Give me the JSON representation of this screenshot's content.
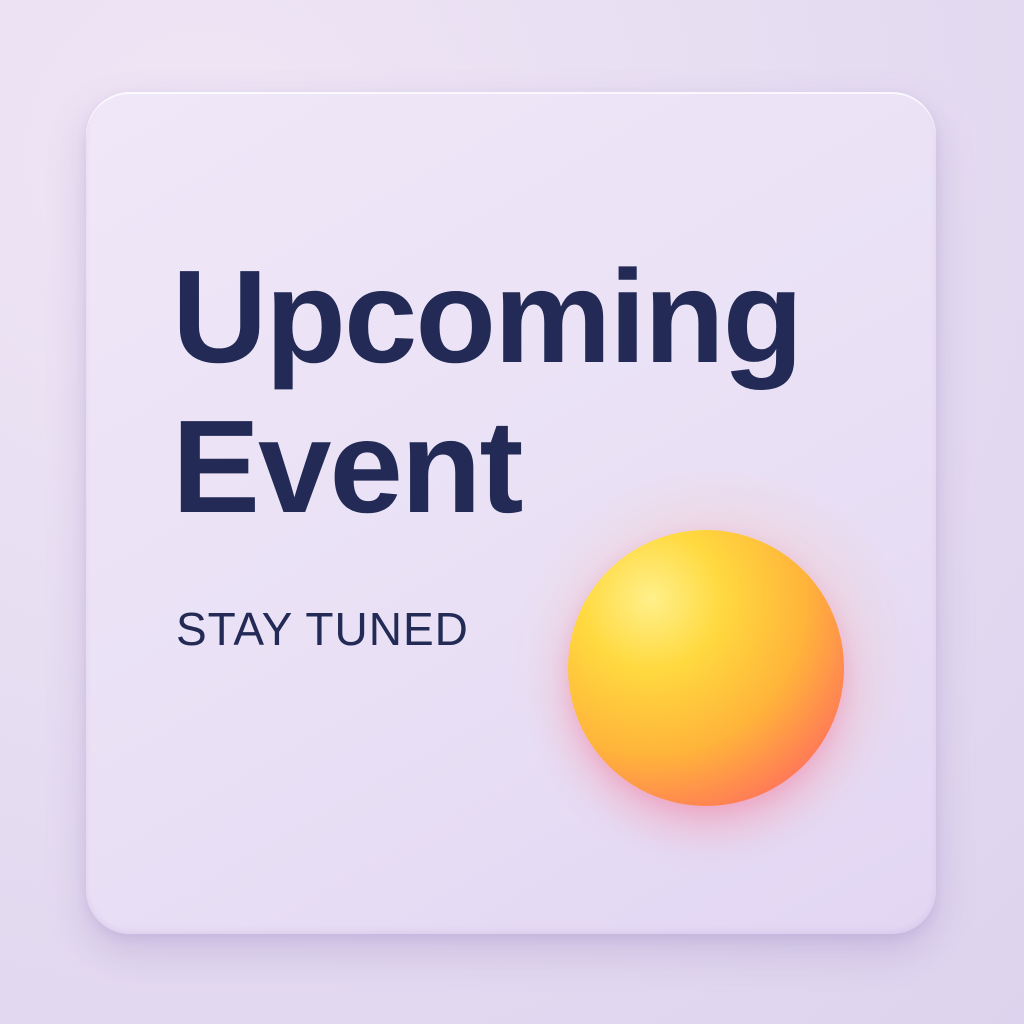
{
  "card": {
    "title": "Upcoming\nEvent",
    "subtitle": "STAY TUNED"
  },
  "colors": {
    "text": "#222a55",
    "orb_top": "#ffd93f",
    "orb_bottom": "#ff4f7a",
    "background": "#e7def2"
  },
  "decor": {
    "orb_name": "gradient-orb"
  }
}
